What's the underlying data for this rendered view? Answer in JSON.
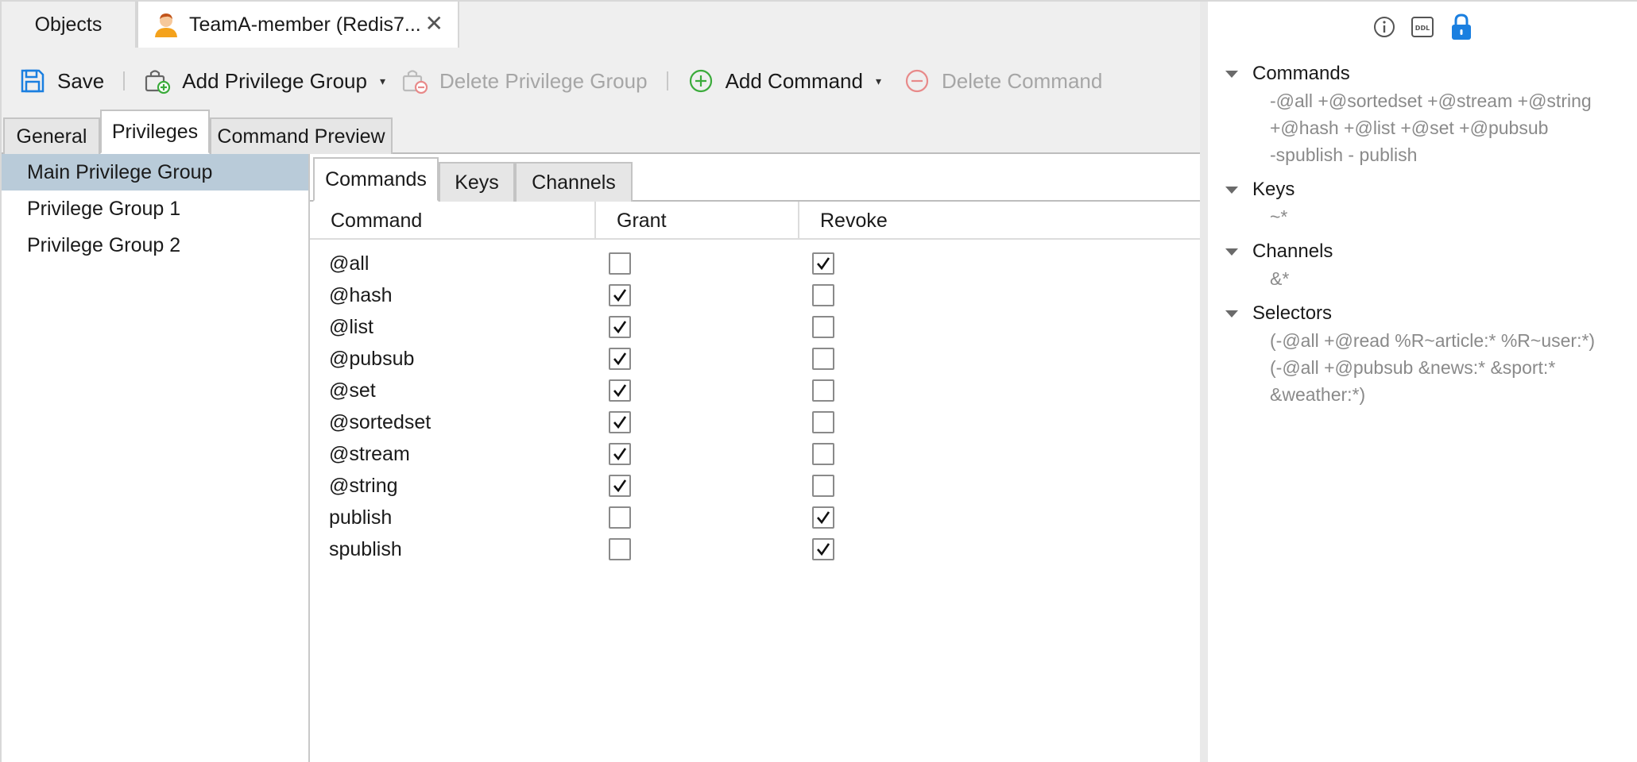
{
  "doc_tabs": {
    "objects_label": "Objects",
    "user_tab_label": "TeamA-member (Redis7...",
    "close_glyph": "✕"
  },
  "toolbar": {
    "save_label": "Save",
    "add_group_label": "Add Privilege Group",
    "delete_group_label": "Delete Privilege Group",
    "add_command_label": "Add Command",
    "delete_command_label": "Delete Command",
    "caret_glyph": "▾"
  },
  "sub_tabs": {
    "general": "General",
    "privileges": "Privileges",
    "preview": "Command Preview"
  },
  "groups": [
    {
      "label": "Main Privilege Group",
      "selected": true
    },
    {
      "label": "Privilege Group 1",
      "selected": false
    },
    {
      "label": "Privilege Group 2",
      "selected": false
    }
  ],
  "inner_tabs": {
    "commands": "Commands",
    "keys": "Keys",
    "channels": "Channels"
  },
  "table": {
    "headers": {
      "command": "Command",
      "grant": "Grant",
      "revoke": "Revoke"
    },
    "rows": [
      {
        "command": "@all",
        "grant": false,
        "revoke": true
      },
      {
        "command": "@hash",
        "grant": true,
        "revoke": false
      },
      {
        "command": "@list",
        "grant": true,
        "revoke": false
      },
      {
        "command": "@pubsub",
        "grant": true,
        "revoke": false
      },
      {
        "command": "@set",
        "grant": true,
        "revoke": false
      },
      {
        "command": "@sortedset",
        "grant": true,
        "revoke": false
      },
      {
        "command": "@stream",
        "grant": true,
        "revoke": false
      },
      {
        "command": "@string",
        "grant": true,
        "revoke": false
      },
      {
        "command": "publish",
        "grant": false,
        "revoke": true
      },
      {
        "command": "spublish",
        "grant": false,
        "revoke": true
      }
    ]
  },
  "right_panel": {
    "icons": [
      "info-icon",
      "ddl-icon",
      "lock-icon"
    ],
    "ddl_text": "DDL",
    "sections": [
      {
        "title": "Commands",
        "lines": [
          "-@all +@sortedset +@stream +@string",
          "+@hash +@list +@set +@pubsub",
          "-spublish - publish"
        ]
      },
      {
        "title": "Keys",
        "lines": [
          "~*"
        ]
      },
      {
        "title": "Channels",
        "lines": [
          "&*"
        ]
      },
      {
        "title": "Selectors",
        "lines": [
          "(-@all +@read %R~article:* %R~user:*)",
          "(-@all +@pubsub &news:* &sport:*",
          "&weather:*)"
        ]
      }
    ]
  },
  "colors": {
    "selected_row": "#b9cbd9",
    "accent_blue": "#1a7fe0",
    "add_green": "#3bab3b",
    "delete_red": "#e88a8a",
    "user_orange": "#f4a21c"
  }
}
